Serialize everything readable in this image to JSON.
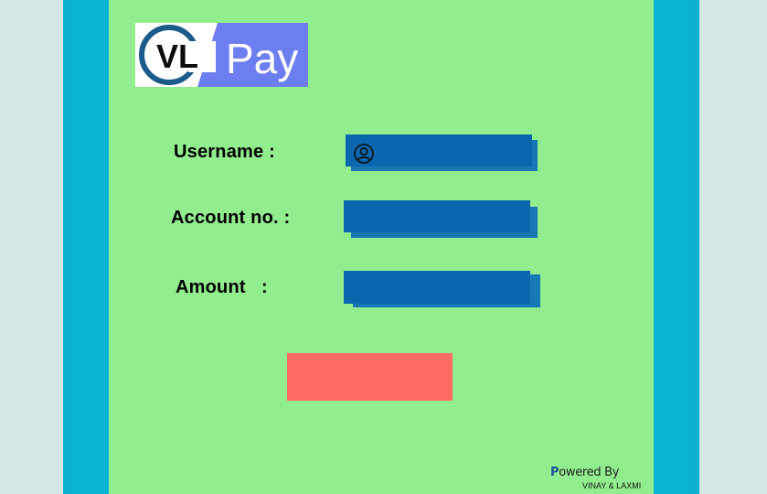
{
  "logo": {
    "brand_initials": "VL",
    "brand_word": "Pay",
    "ring_color": "#1b5b8a",
    "pay_color": "#6c7ef0"
  },
  "form": {
    "username_label": "Username :",
    "account_label": "Account no. :",
    "amount_label": "Amount   :",
    "username_value": "",
    "account_value": "",
    "amount_value": "",
    "submit_label": ""
  },
  "footer": {
    "powered_first": "P",
    "powered_rest": "owered By",
    "authors": "VINAY & LAXMI"
  },
  "colors": {
    "panel": "#92ed8e",
    "frame": "#0ab2cf",
    "field": "#0a67ad",
    "button": "#ff6b63"
  },
  "icons": {
    "username": "user-circle-icon"
  }
}
